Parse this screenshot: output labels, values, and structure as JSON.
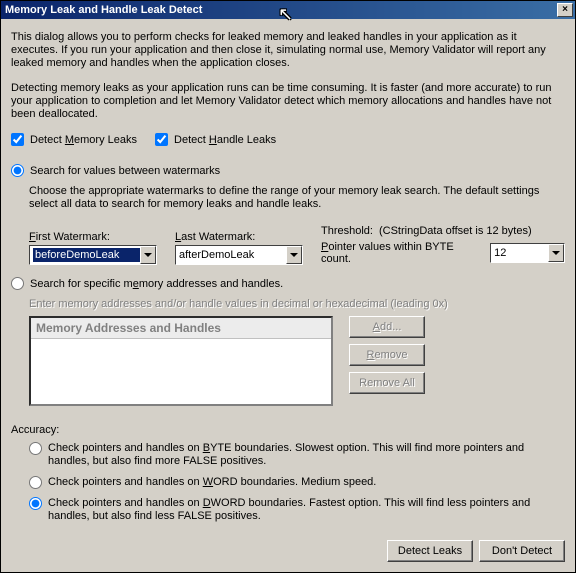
{
  "title": "Memory Leak and Handle Leak Detect",
  "intro1": "This dialog allows you to perform checks for leaked memory and leaked handles in your application as it executes. If you run your application and then close it, simulating normal use, Memory Validator will report any leaked memory and handles when the application closes.",
  "intro2": "Detecting memory leaks as your application runs can be time consuming. It is faster (and more accurate) to run your application to completion and let Memory Validator detect which memory allocations and handles have not been deallocated.",
  "cbMemory_pre": "Detect ",
  "cbMemory_u": "M",
  "cbMemory_post": "emory Leaks",
  "cbHandle_pre": "Detect ",
  "cbHandle_u": "H",
  "cbHandle_post": "andle Leaks",
  "radioWatermarks": "Search for values between watermarks",
  "watermarkHelp": "Choose the appropriate watermarks to define the range of your memory leak search. The default settings select all data to search for memory leaks and handle leaks.",
  "firstWatermarkLabel_u": "F",
  "firstWatermarkLabel_post": "irst Watermark:",
  "lastWatermarkLabel_u": "L",
  "lastWatermarkLabel_post": "ast Watermark:",
  "firstWatermarkValue": "beforeDemoLeak",
  "lastWatermarkValue": "afterDemoLeak",
  "thresholdLabel": "Threshold:",
  "thresholdNote": "(CStringData offset is 12 bytes)",
  "pointerLabel_u": "P",
  "pointerLabel_post": "ointer values within BYTE count.",
  "pointerValue": "12",
  "radioSpecific_pre": "Search for specific m",
  "radioSpecific_u": "e",
  "radioSpecific_post": "mory addresses and handles.",
  "enterHint": "Enter memory addresses and/or handle values in decimal or hexadecimal (leading 0x)",
  "listHeader": "Memory Addresses and Handles",
  "btnAdd_u": "A",
  "btnAdd_post": "dd...",
  "btnRemove_u": "R",
  "btnRemove_post": "emove",
  "btnRemoveAll": "Remove All",
  "accuracyLabel": "Accuracy:",
  "accByte_pre": "Check pointers and handles on ",
  "accByte_u": "B",
  "accByte_post": "YTE boundaries. Slowest option. This will find more pointers and handles, but also find more FALSE positives.",
  "accWord_pre": "Check pointers and handles on ",
  "accWord_u": "W",
  "accWord_post": "ORD boundaries. Medium speed.",
  "accDword_pre": "Check pointers and handles on ",
  "accDword_u": "D",
  "accDword_post": "WORD boundaries. Fastest option. This will find less pointers and handles, but also find less FALSE positives.",
  "btnDetect": "Detect Leaks",
  "btnDont": "Don't Detect"
}
